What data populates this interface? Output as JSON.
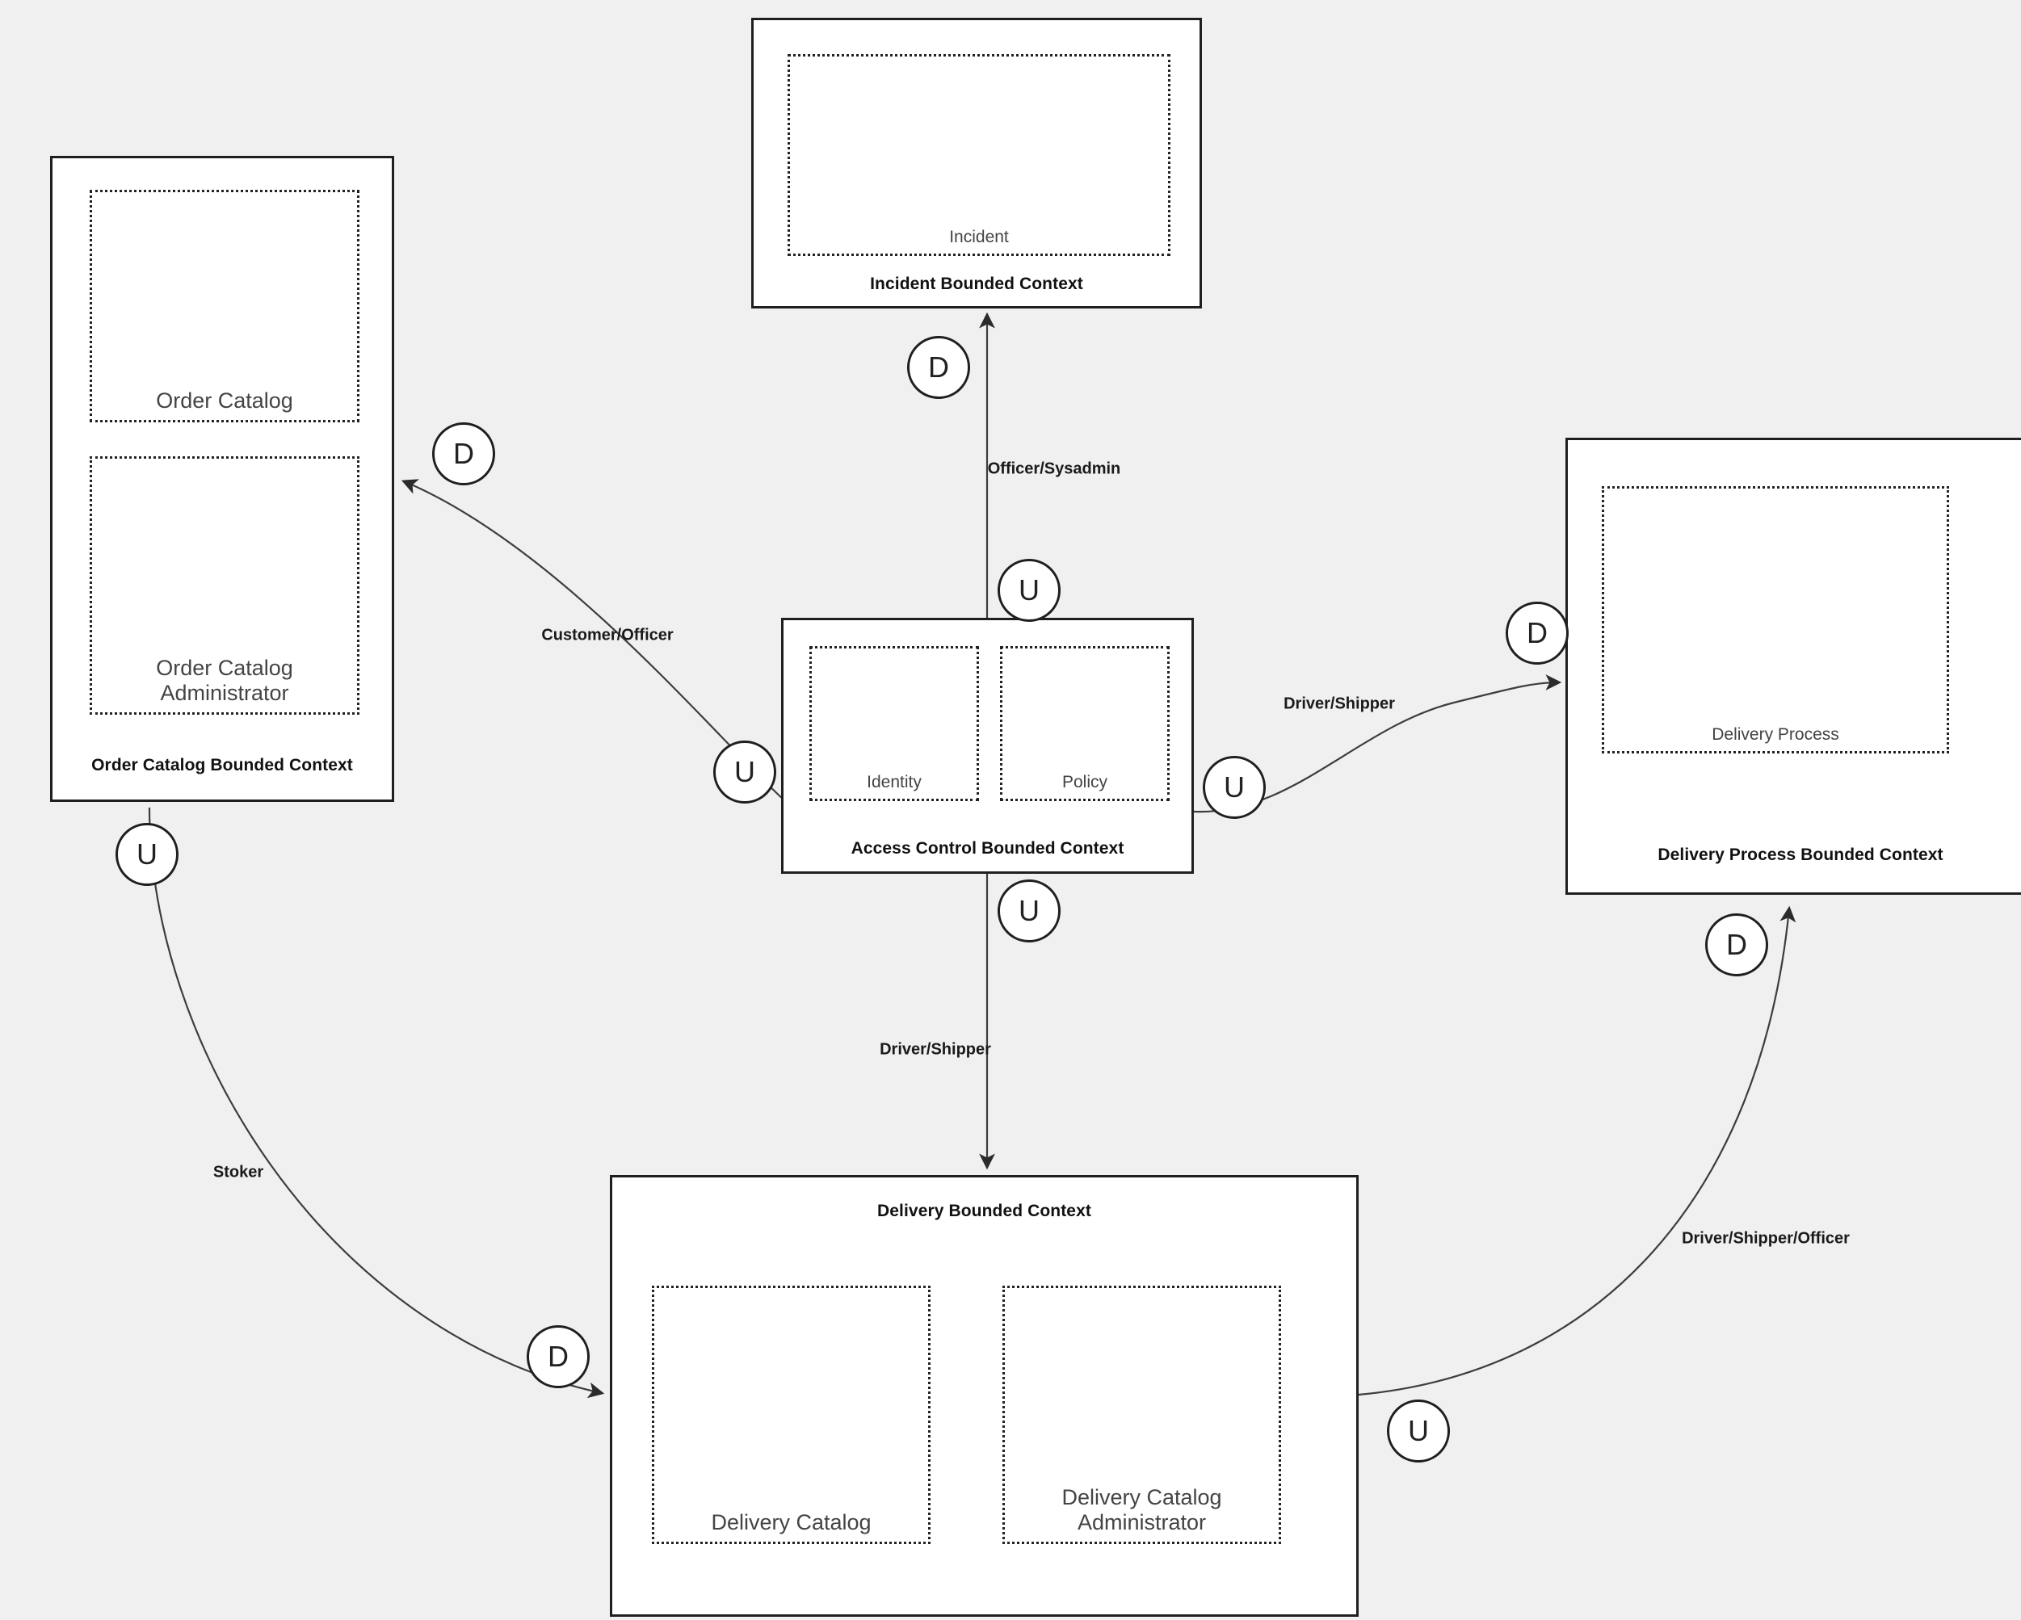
{
  "diagram": {
    "type": "context-map",
    "background_color": "#f0f0f0",
    "box_fill": "#ffffff",
    "box_stroke": "#1f1f1f",
    "aggregate_stroke": "#222222",
    "edge_stroke": "#3d3d3d"
  },
  "contexts": [
    {
      "id": "incident",
      "title": "Incident Bounded Context",
      "title_position": "bottom",
      "aggregates": [
        {
          "id": "incident-agg",
          "label": "Incident"
        }
      ]
    },
    {
      "id": "order-catalog",
      "title": "Order Catalog Bounded Context",
      "title_position": "bottom",
      "aggregates": [
        {
          "id": "order-catalog-agg",
          "label": "Order Catalog"
        },
        {
          "id": "order-catalog-admin-agg",
          "label": "Order Catalog Administrator"
        }
      ]
    },
    {
      "id": "access-control",
      "title": "Access Control Bounded Context",
      "title_position": "bottom",
      "aggregates": [
        {
          "id": "identity-agg",
          "label": "Identity"
        },
        {
          "id": "policy-agg",
          "label": "Policy"
        }
      ]
    },
    {
      "id": "delivery-process",
      "title": "Delivery Process Bounded Context",
      "title_position": "bottom",
      "aggregates": [
        {
          "id": "delivery-process-agg",
          "label": "Delivery Process"
        }
      ]
    },
    {
      "id": "delivery",
      "title": "Delivery Bounded Context",
      "title_position": "top",
      "aggregates": [
        {
          "id": "delivery-catalog-agg",
          "label": "Delivery Catalog"
        },
        {
          "id": "delivery-catalog-admin-agg",
          "label": "Delivery Catalog Administrator"
        }
      ]
    }
  ],
  "relationships": [
    {
      "id": "access-control-to-incident",
      "from": "access-control",
      "to": "incident",
      "label": "Officer/Sysadmin",
      "upstream_marker": "U",
      "downstream_marker": "D"
    },
    {
      "id": "access-control-to-order-catalog",
      "from": "access-control",
      "to": "order-catalog",
      "label": "Customer/Officer",
      "upstream_marker": "U",
      "downstream_marker": "D"
    },
    {
      "id": "access-control-to-delivery-process",
      "from": "access-control",
      "to": "delivery-process",
      "label": "Driver/Shipper",
      "upstream_marker": "U",
      "downstream_marker": "D"
    },
    {
      "id": "access-control-to-delivery",
      "from": "access-control",
      "to": "delivery",
      "label": "Driver/Shipper",
      "upstream_marker": "U",
      "downstream_marker": null
    },
    {
      "id": "order-catalog-to-delivery",
      "from": "order-catalog",
      "to": "delivery",
      "label": "Stoker",
      "upstream_marker": "U",
      "downstream_marker": "D"
    },
    {
      "id": "delivery-to-delivery-process",
      "from": "delivery",
      "to": "delivery-process",
      "label": "Driver/Shipper/Officer",
      "upstream_marker": "U",
      "downstream_marker": "D"
    }
  ],
  "badges": {
    "upstream": "U",
    "downstream": "D"
  }
}
